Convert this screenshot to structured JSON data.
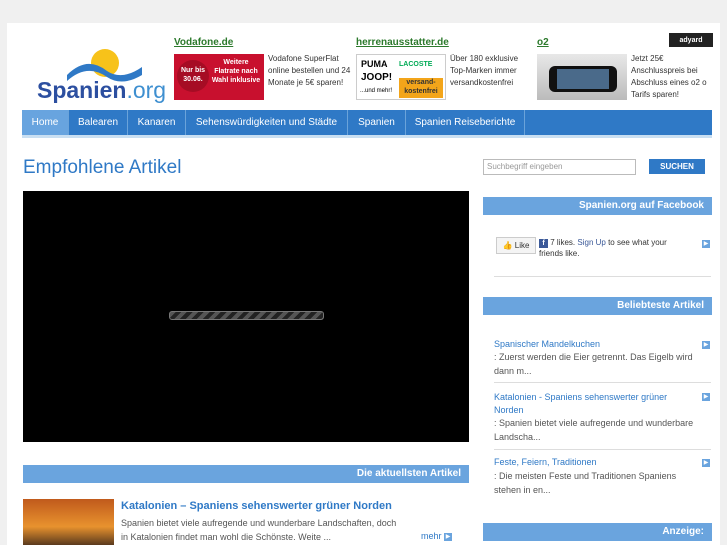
{
  "logo": {
    "name": "Spanien",
    "tld": ".org"
  },
  "ads": [
    {
      "head": "Vodafone.de",
      "img_text": "Nur bis 30.06. | Weitere Flatrate nach Wahl inklusive",
      "desc": "Vodafone SuperFlat online bestellen und 24 Monate je 5€ sparen!"
    },
    {
      "head": "herrenausstatter.de",
      "img_text": "PUMA JOOP! LACOSTE ...und mehr! versandkostenfrei",
      "desc": "Über 180 exklusive Top-Marken immer versandkostenfrei"
    },
    {
      "head": "o2",
      "img_text": "",
      "desc": "Jetzt 25€ Anschlusspreis bei Abschluss eines o2 o Tarifs sparen!"
    }
  ],
  "adyard": "adyard",
  "nav": [
    "Home",
    "Balearen",
    "Kanaren",
    "Sehenswürdigkeiten und Städte",
    "Spanien",
    "Spanien Reiseberichte"
  ],
  "main_title": "Empfohlene Artikel",
  "latest_header": "Die aktuellsten Artikel",
  "article": {
    "title": "Katalonien – Spaniens sehenswerter grüner Norden",
    "text": "Spanien bietet viele aufregende und wunderbare Landschaften, doch in Katalonien findet man wohl die Schönste. Weite ...",
    "more": "mehr"
  },
  "search": {
    "placeholder": "Suchbegriff eingeben",
    "button": "SUCHEN"
  },
  "facebook": {
    "header": "Spanien.org auf Facebook",
    "like": "Like",
    "likes": "7 likes.",
    "signup": "Sign Up",
    "rest": "to see what your friends like."
  },
  "popular": {
    "header": "Beliebteste Artikel",
    "items": [
      {
        "title": "Spanischer Mandelkuchen",
        "desc": ": Zuerst werden die Eier getrennt. Das Eigelb wird dann m..."
      },
      {
        "title": "Katalonien - Spaniens sehenswerter grüner Norden",
        "desc": ": Spanien bietet viele aufregende und wunderbare Landscha..."
      },
      {
        "title": "Feste, Feiern, Traditionen",
        "desc": ": Die meisten Feste und Traditionen Spaniens stehen in en..."
      }
    ]
  },
  "anzeige": "Anzeige:"
}
